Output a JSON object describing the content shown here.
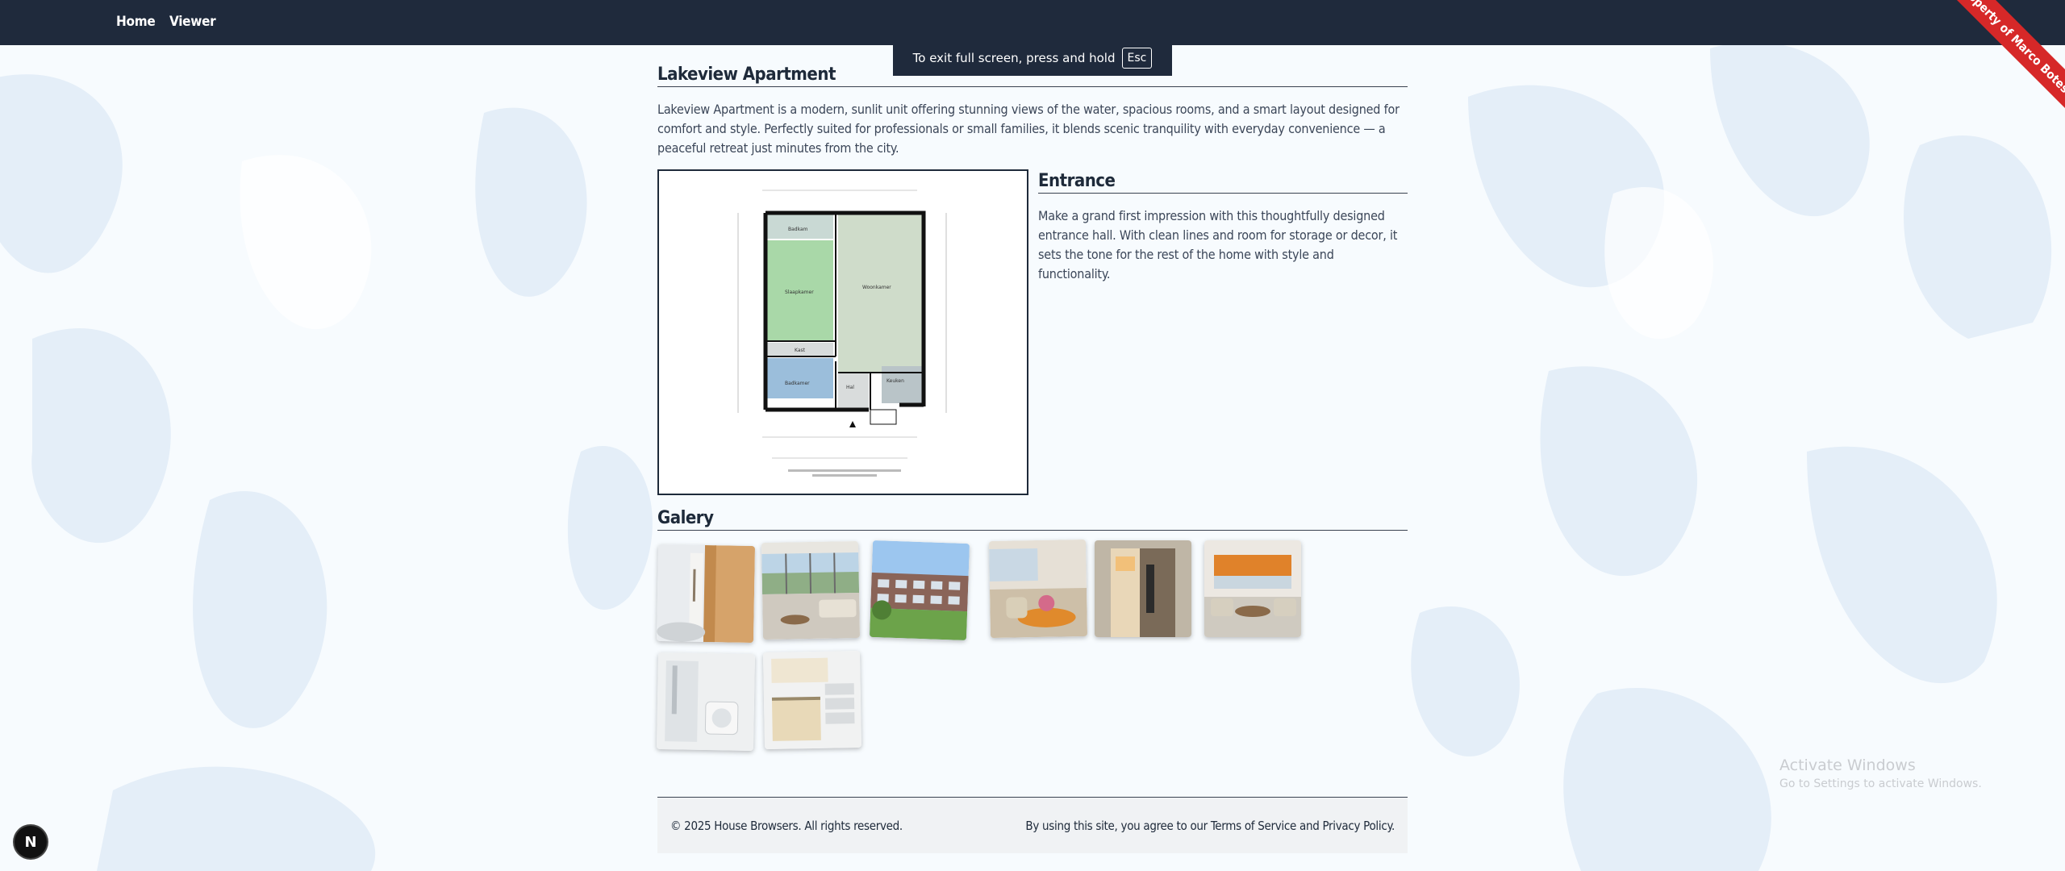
{
  "nav": {
    "home_label": "Home",
    "viewer_label": "Viewer"
  },
  "ribbon": {
    "text": "Property of Marco Botes"
  },
  "fullscreen_notice": {
    "text": "To exit full screen, press and hold",
    "key": "Esc"
  },
  "listing": {
    "title": "Lakeview Apartment",
    "description": "Lakeview Apartment is a modern, sunlit unit offering stunning views of the water, spacious rooms, and a smart layout designed for comfort and style. Perfectly suited for professionals or small families, it blends scenic tranquility with everyday convenience — a peaceful retreat just minutes from the city."
  },
  "feature": {
    "title": "Entrance",
    "description": "Make a grand first impression with this thoughtfully designed entrance hall. With clean lines and room for storage or decor, it sets the tone for the rest of the home with style and functionality.",
    "floorplan": {
      "rooms": [
        "Badkam",
        "Slaapkamer",
        "Woonkamer",
        "Kast",
        "Badkamer",
        "Hal",
        "Keuken"
      ]
    }
  },
  "gallery": {
    "title": "Galery",
    "items": [
      {
        "name": "Entrance wardrobe"
      },
      {
        "name": "Living room windows"
      },
      {
        "name": "Building exterior"
      },
      {
        "name": "Dining area"
      },
      {
        "name": "Kitchen doorway"
      },
      {
        "name": "Living room with orange blinds"
      },
      {
        "name": "Bathroom"
      },
      {
        "name": "Kitchen"
      }
    ]
  },
  "footer": {
    "copyright": "© 2025 House Browsers. All rights reserved.",
    "terms": "By using this site, you agree to our Terms of Service and Privacy Policy."
  },
  "os_overlay": {
    "line1": "Activate Windows",
    "line2": "Go to Settings to activate Windows."
  },
  "dev_badge": {
    "letter": "N"
  }
}
